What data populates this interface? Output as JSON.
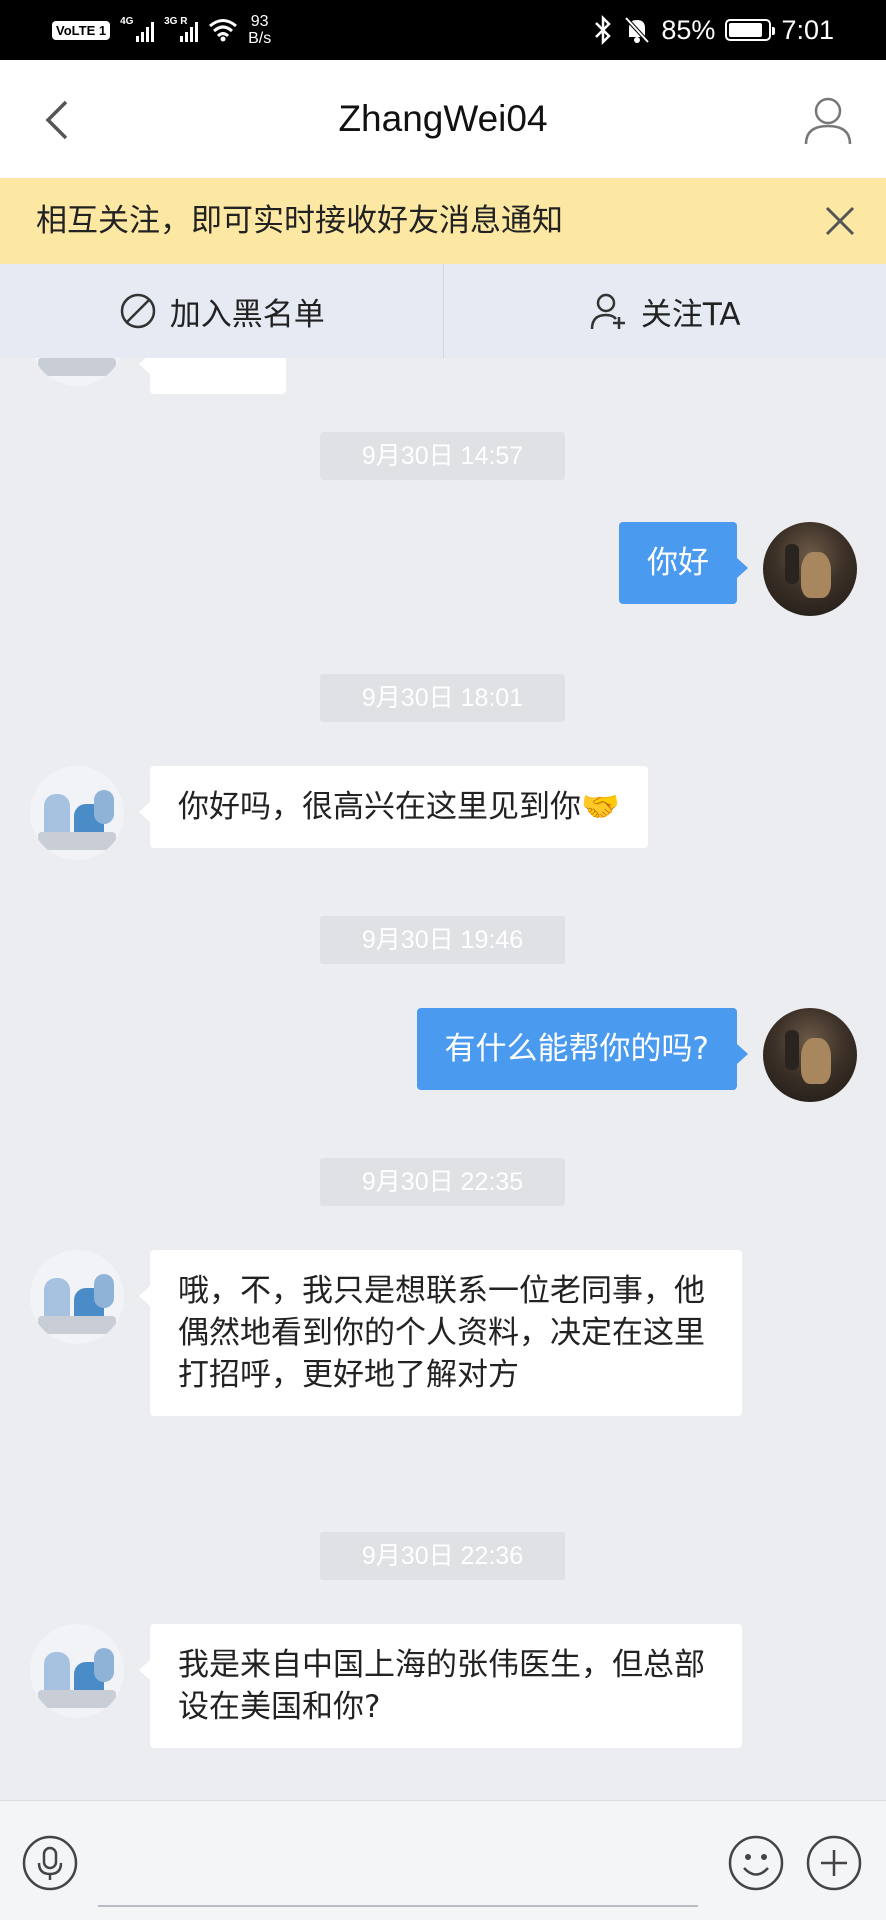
{
  "status_bar": {
    "volte": "VoLTE 1",
    "sig1_tag": "4G",
    "sig2_tag": "3G R",
    "speed_value": "93",
    "speed_unit": "B/s",
    "battery": "85%",
    "time": "7:01",
    "icons": [
      "bluetooth-icon",
      "silent-icon",
      "battery-icon",
      "wifi-icon"
    ]
  },
  "header": {
    "title": "ZhangWei04",
    "back_icon": "chevron-left-icon",
    "profile_icon": "user-icon"
  },
  "banner": {
    "text": "相互关注，即可实时接收好友消息通知",
    "close_icon": "close-icon"
  },
  "actions": {
    "block_label": "加入黑名单",
    "follow_label": "关注TA"
  },
  "messages": [
    {
      "timestamp": "9月30日 14:57",
      "sender": "me",
      "text": "你好"
    },
    {
      "timestamp": "9月30日 18:01",
      "sender": "them",
      "text": "你好吗，很高兴在这里见到你🤝"
    },
    {
      "timestamp": "9月30日 19:46",
      "sender": "me",
      "text": "有什么能帮你的吗?"
    },
    {
      "timestamp": "9月30日 22:35",
      "sender": "them",
      "text": "哦，不，我只是想联系一位老同事，他偶然地看到你的个人资料，决定在这里打招呼，更好地了解对方"
    },
    {
      "timestamp": "9月30日 22:36",
      "sender": "them",
      "text": "我是来自中国上海的张伟医生，但总部设在美国和你?"
    }
  ],
  "input_bar": {
    "placeholder": "",
    "icons": [
      "microphone-icon",
      "emoji-icon",
      "plus-icon"
    ]
  },
  "colors": {
    "chat_bg": "#ebedf1",
    "outgoing_bubble": "#4a9af0",
    "banner_bg": "#fce7a3",
    "action_bar_bg": "#e6eaf2"
  }
}
